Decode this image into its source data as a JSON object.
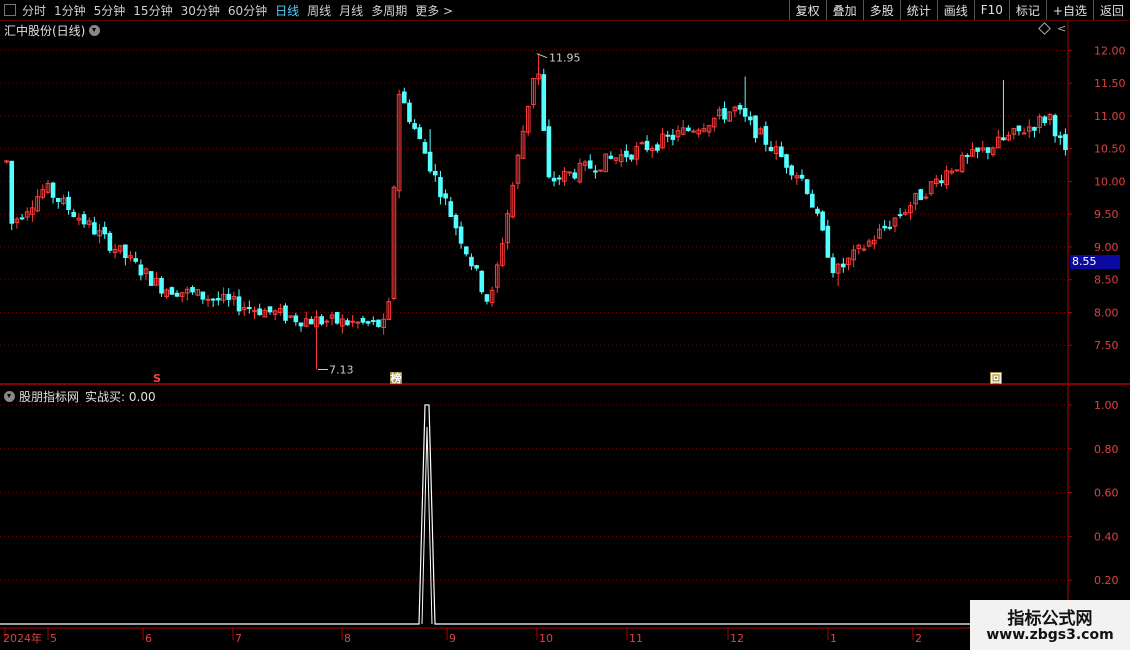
{
  "toolbar": {
    "periods": [
      "分时",
      "1分钟",
      "5分钟",
      "15分钟",
      "30分钟",
      "60分钟",
      "日线",
      "周线",
      "月线",
      "多周期",
      "更多"
    ],
    "active_period": "日线",
    "more_chevron": ">",
    "buttons": [
      "复权",
      "叠加",
      "多股",
      "统计",
      "画线",
      "F10",
      "标记",
      "+自选",
      "返回"
    ]
  },
  "main_panel": {
    "title": "汇中股份(日线)",
    "price_axis_labels": [
      "12.00",
      "11.50",
      "11.00",
      "10.50",
      "10.00",
      "9.50",
      "9.00",
      "8.50",
      "8.00",
      "7.50"
    ],
    "current_price_tag": "8.55",
    "high_annotation": "11.95",
    "low_annotation": "7.13",
    "event_markers": [
      "S",
      "榜",
      "回"
    ]
  },
  "sub_panel": {
    "title": "股朋指标网",
    "indicator_label": "实战买: 0.00",
    "axis_labels": [
      "1.00",
      "0.80",
      "0.60",
      "0.40",
      "0.20"
    ]
  },
  "date_axis": {
    "labels": [
      "2024年",
      "5",
      "6",
      "7",
      "8",
      "9",
      "10",
      "11",
      "12",
      "1",
      "2"
    ]
  },
  "watermark": {
    "line1": "指标公式网",
    "line2": "www.zbgs3.com"
  },
  "colors": {
    "up": "#ff3c3c",
    "down": "#54ffff",
    "grid": "#7a0000",
    "frame": "#b00000",
    "active_period": "#5ad0ff",
    "price_tag_bg": "#0a0aa0"
  },
  "chart_data": {
    "type": "candlestick",
    "title": "汇中股份(日线)",
    "ylim": [
      7.0,
      12.25
    ],
    "y_ticks": [
      12.0,
      11.5,
      11.0,
      10.5,
      10.0,
      9.5,
      9.0,
      8.5,
      8.0,
      7.5
    ],
    "x_month_labels": [
      "2024年",
      "5",
      "6",
      "7",
      "8",
      "9",
      "10",
      "11",
      "12",
      "1",
      "2"
    ],
    "approx_close_path": [
      {
        "month": "2024年",
        "close": 9.3
      },
      {
        "month": "5",
        "close": 9.9
      },
      {
        "month": "6",
        "close": 8.4
      },
      {
        "month": "7",
        "close": 7.9
      },
      {
        "month": "8",
        "close": 7.8
      },
      {
        "month": "8",
        "close": 11.4
      },
      {
        "month": "9",
        "close": 8.1
      },
      {
        "month": "10",
        "close": 11.9
      },
      {
        "month": "10",
        "close": 10.0
      },
      {
        "month": "11",
        "close": 10.6
      },
      {
        "month": "12",
        "close": 11.1
      },
      {
        "month": "12",
        "close": 10.0
      },
      {
        "month": "1",
        "close": 8.6
      },
      {
        "month": "2",
        "close": 10.2
      },
      {
        "month": "2",
        "close": 11.0
      },
      {
        "month": "2",
        "close": 10.3
      }
    ],
    "period_high": 11.95,
    "period_low": 7.13,
    "last_price": 8.55,
    "sub_indicator": {
      "name": "实战买",
      "current": 0.0,
      "ylim": [
        0,
        1.05
      ],
      "y_ticks": [
        1.0,
        0.8,
        0.6,
        0.4,
        0.2
      ],
      "signal": [
        {
          "month": "8",
          "value": 1.0
        }
      ]
    }
  }
}
